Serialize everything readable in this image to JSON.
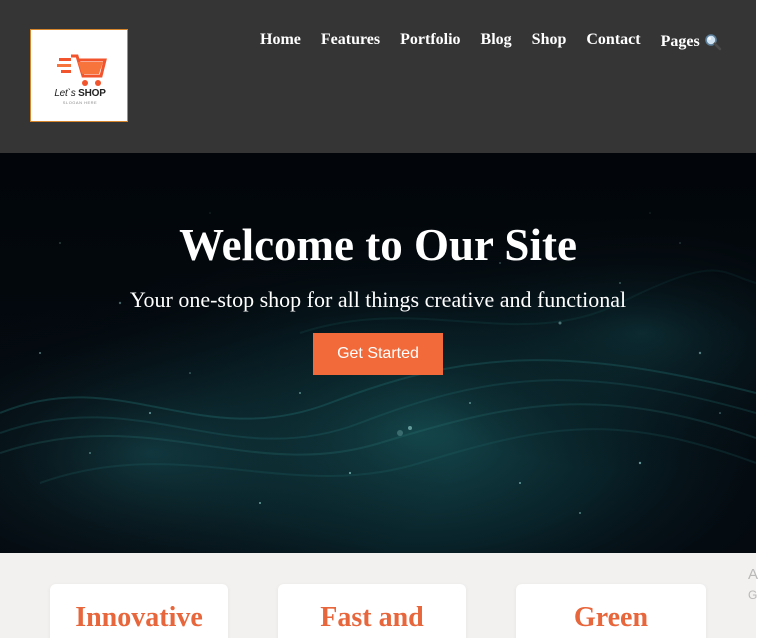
{
  "header": {
    "logo": {
      "text_lets": "Let`s",
      "text_shop": "SHOP",
      "slogan": "SLOGAN HERE",
      "brand_color": "#f2542d"
    },
    "nav": [
      {
        "label": "Home"
      },
      {
        "label": "Features"
      },
      {
        "label": "Portfolio"
      },
      {
        "label": "Blog"
      },
      {
        "label": "Shop"
      },
      {
        "label": "Contact"
      }
    ],
    "pages_label": "Pages",
    "search_icon": "search-icon",
    "background": "#353535"
  },
  "hero": {
    "title": "Welcome to Our Site",
    "subtitle": "Your one-stop shop for all things creative and functional",
    "button_label": "Get Started",
    "button_color": "#f26a3a"
  },
  "features": {
    "cards": [
      {
        "title": "Innovative"
      },
      {
        "title": "Fast and"
      },
      {
        "title": "Green"
      }
    ],
    "title_color": "#e8663b"
  },
  "watermark": {
    "line1": "A",
    "line2": "G"
  }
}
